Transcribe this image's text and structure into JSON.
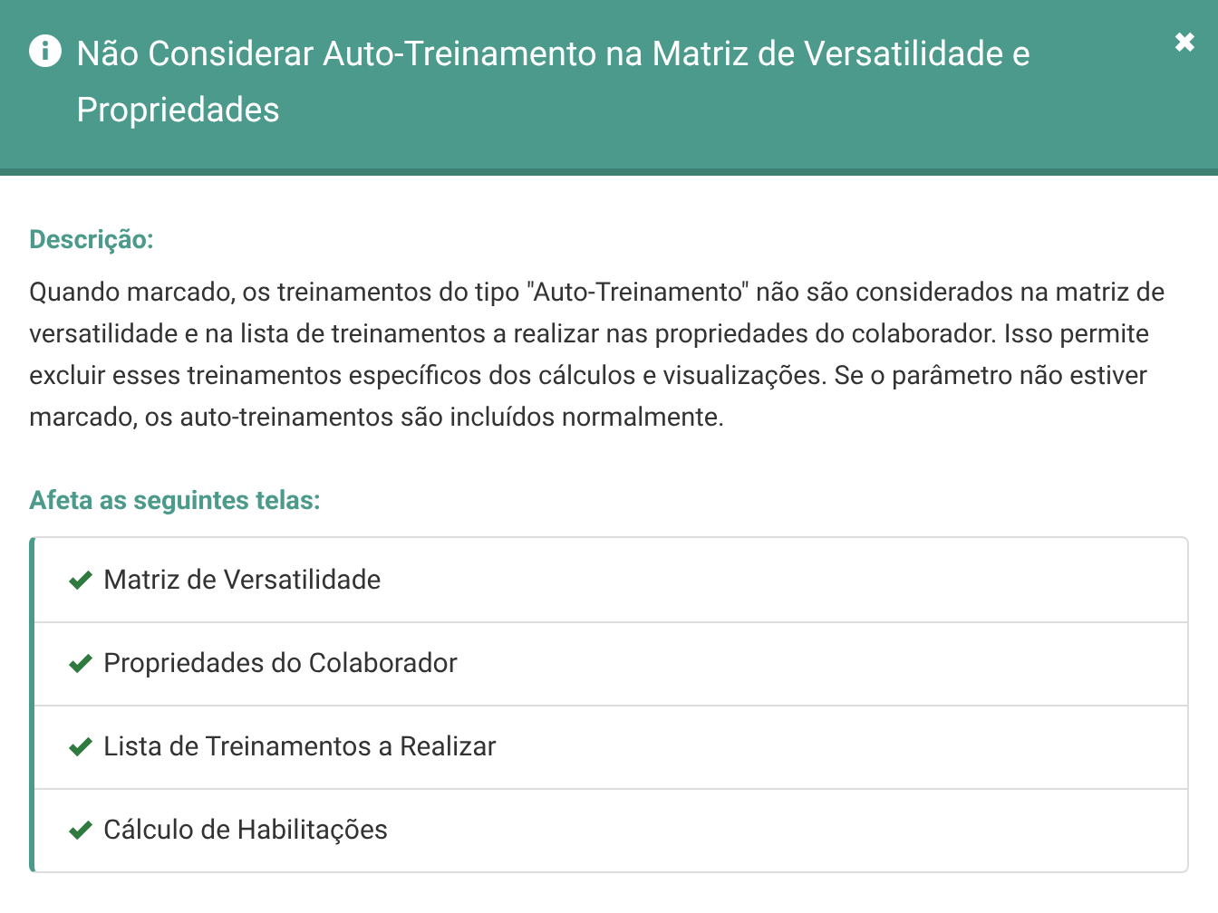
{
  "dialog": {
    "title": "Não Considerar Auto-Treinamento na Matriz de Versatilidade e Propriedades",
    "close": "✖"
  },
  "description": {
    "label": "Descrição:",
    "text": "Quando marcado, os treinamentos do tipo \"Auto-Treinamento\" não são considerados na matriz de versatilidade e na lista de treinamentos a realizar nas propriedades do colaborador. Isso permite excluir esses treinamentos específicos dos cálculos e visualizações. Se o parâmetro não estiver marcado, os auto-treinamentos são incluídos normalmente."
  },
  "affected": {
    "label": "Afeta as seguintes telas:",
    "items": [
      {
        "label": "Matriz de Versatilidade"
      },
      {
        "label": "Propriedades do Colaborador"
      },
      {
        "label": "Lista de Treinamentos a Realizar"
      },
      {
        "label": "Cálculo de Habilitações"
      }
    ]
  }
}
